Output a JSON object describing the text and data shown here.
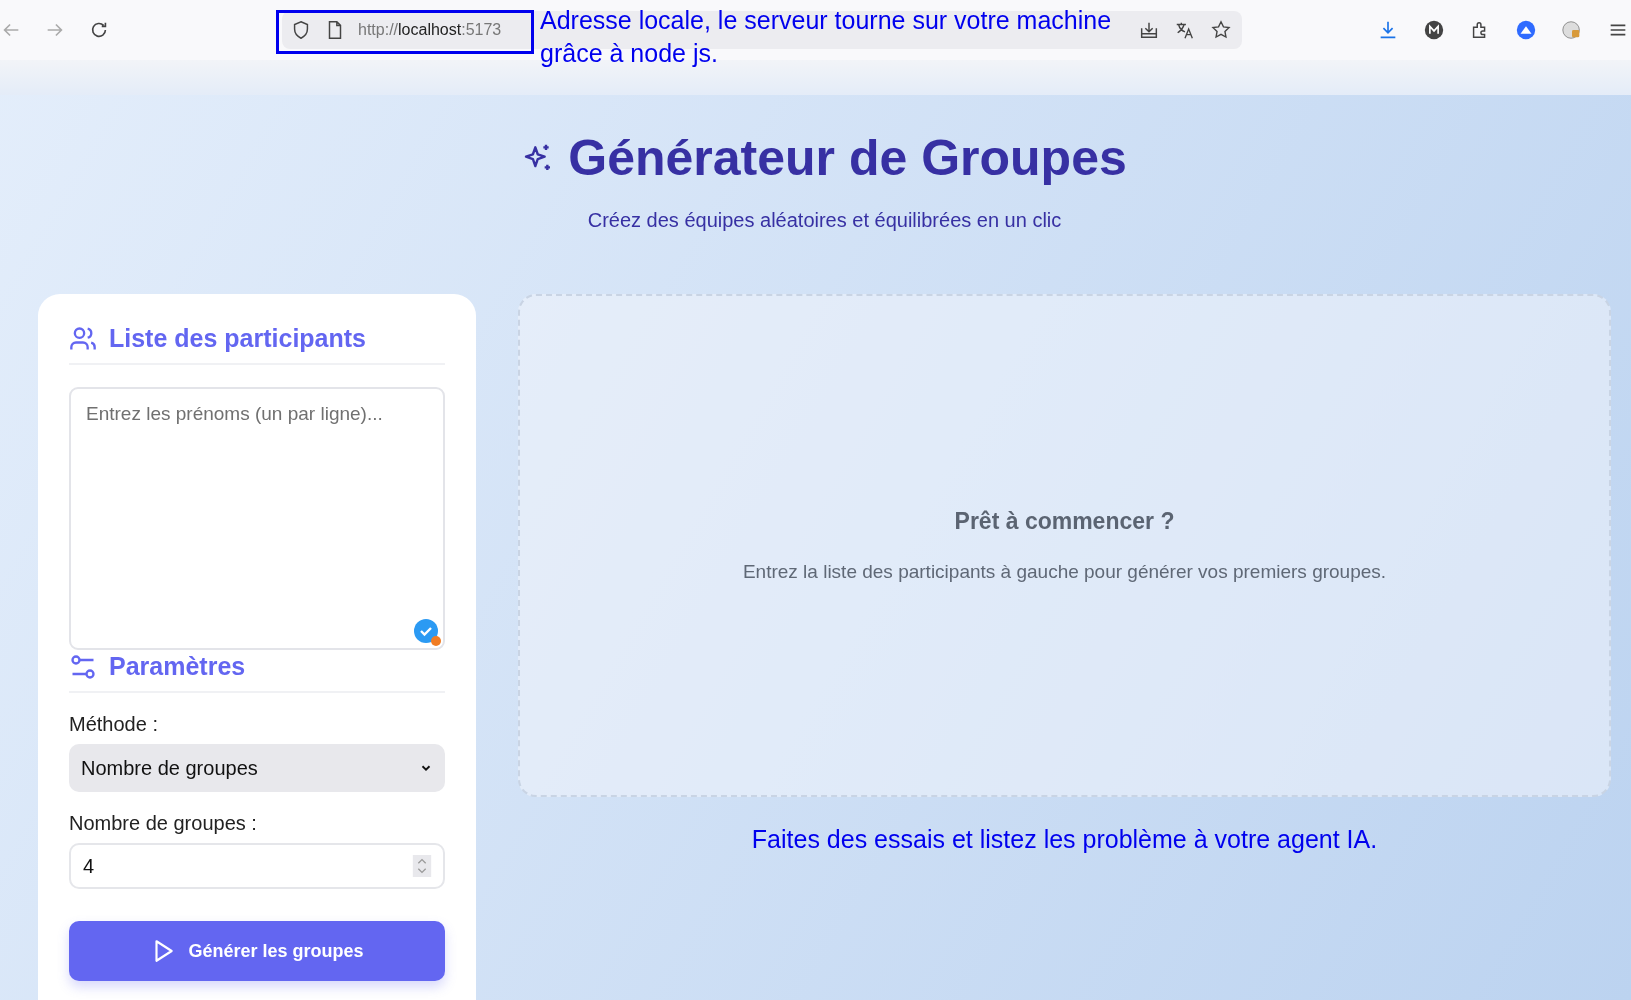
{
  "browser": {
    "url_scheme": "http://",
    "url_host": "localhost",
    "url_port": ":5173"
  },
  "address_note": {
    "lines": [
      "Adresse locale, le serveur tourne sur votre machine",
      "grâce à node js."
    ]
  },
  "header": {
    "title": "Générateur de Groupes",
    "subtitle": "Créez des équipes aléatoires et équilibrées en un clic"
  },
  "participants": {
    "title": "Liste des participants",
    "placeholder": "Entrez les prénoms (un par ligne)..."
  },
  "settings": {
    "title": "Paramètres",
    "method_label": "Méthode :",
    "method_value": "Nombre de groupes",
    "count_label": "Nombre de groupes :",
    "count_value": "4"
  },
  "generate_button": "Générer les groupes",
  "empty_state": {
    "title": "Prêt à commencer ?",
    "text": "Entrez la liste des participants à gauche pour générer vos premiers groupes."
  },
  "note": "Faites des essais et listez les problème à votre agent IA."
}
